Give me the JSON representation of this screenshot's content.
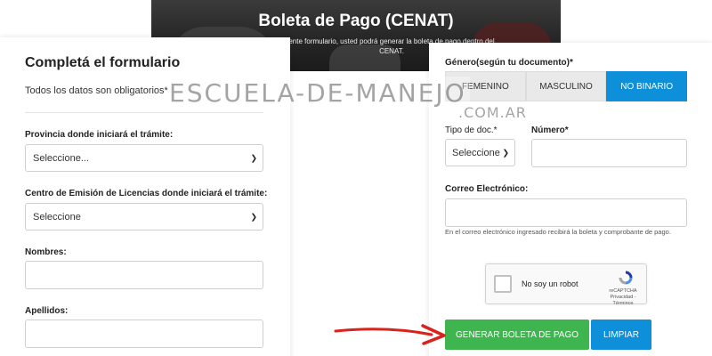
{
  "banner": {
    "title": "Boleta de Pago (CENAT)",
    "subtitle": "ente formulario, usted podrá generar la boleta de pago dentro del CENAT."
  },
  "form": {
    "title": "Completá el formulario",
    "subtitle": "Todos los datos son obligatorios*",
    "provincia_label": "Provincia donde iniciará el trámite:",
    "provincia_value": "Seleccione...",
    "centro_label": "Centro de Emisión de Licencias donde iniciará el trámite:",
    "centro_value": "Seleccione",
    "nombres_label": "Nombres:",
    "nombres_value": "",
    "apellidos_label": "Apellidos:",
    "apellidos_value": ""
  },
  "right": {
    "genero_label": "Género(según tu documento)*",
    "genero_options": [
      "FEMENINO",
      "MASCULINO",
      "NO BINARIO"
    ],
    "genero_selected": "NO BINARIO",
    "tipodoc_label": "Tipo de doc.*",
    "tipodoc_value": "Seleccione",
    "numero_label": "Número*",
    "numero_value": "",
    "correo_label": "Correo Electrónico:",
    "correo_value": "",
    "correo_hint": "En el correo electrónico ingresado recibirá la boleta y comprobante de pago.",
    "captcha_text": "No soy un robot",
    "captcha_brand": "reCAPTCHA",
    "captcha_links": "Privacidad - Términos",
    "generar_label": "GENERAR BOLETA DE PAGO",
    "limpiar_label": "LIMPIAR"
  },
  "watermark": {
    "main": "ESCUELA-DE-MANEJO",
    "suffix": ".COM.AR"
  },
  "colors": {
    "accent_blue": "#0d8fd9",
    "green": "#3fb54f",
    "arrow_red": "#d9231d"
  }
}
